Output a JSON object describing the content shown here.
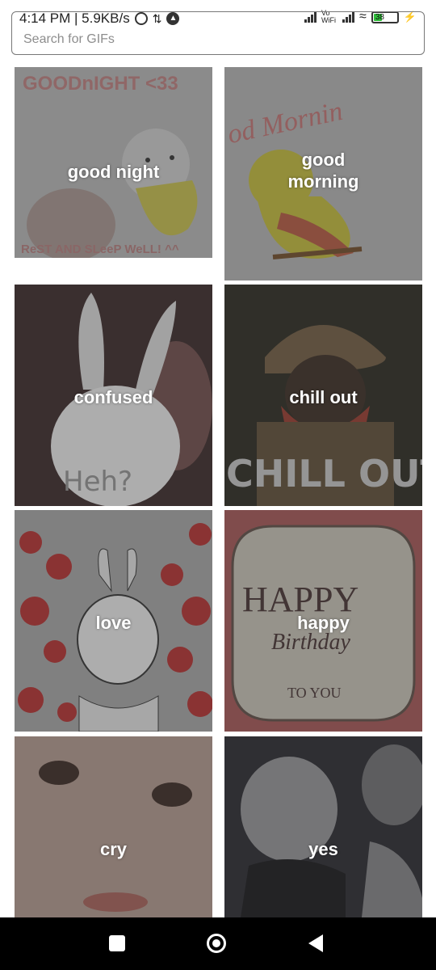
{
  "status_bar": {
    "time_speed": "4:14 PM | 5.9KB/s",
    "vowifi": "Vo WiFi",
    "battery": "38"
  },
  "search": {
    "placeholder": "Search for GIFs"
  },
  "gifs": [
    {
      "label": "good night"
    },
    {
      "label": "good\nmorning"
    },
    {
      "label": "confused"
    },
    {
      "label": "chill out"
    },
    {
      "label": "love"
    },
    {
      "label": "happy"
    },
    {
      "label": "cry"
    },
    {
      "label": "yes"
    }
  ],
  "gif_art_text": {
    "goodnight_top": "GOODnIGHT <33",
    "goodnight_bottom": "ReST AND SLeeP WeLL! ^^",
    "morning_arc": "od Mornin",
    "confused_caption": "Heh?",
    "chill_caption": "CHILL OUT!",
    "bday_happy": "HAPPY",
    "bday_birthday": "Birthday",
    "bday_toyou": "TO YOU"
  },
  "colors": {
    "nav_bg": "#000000",
    "tile_overlay": "#3c3c3c"
  }
}
